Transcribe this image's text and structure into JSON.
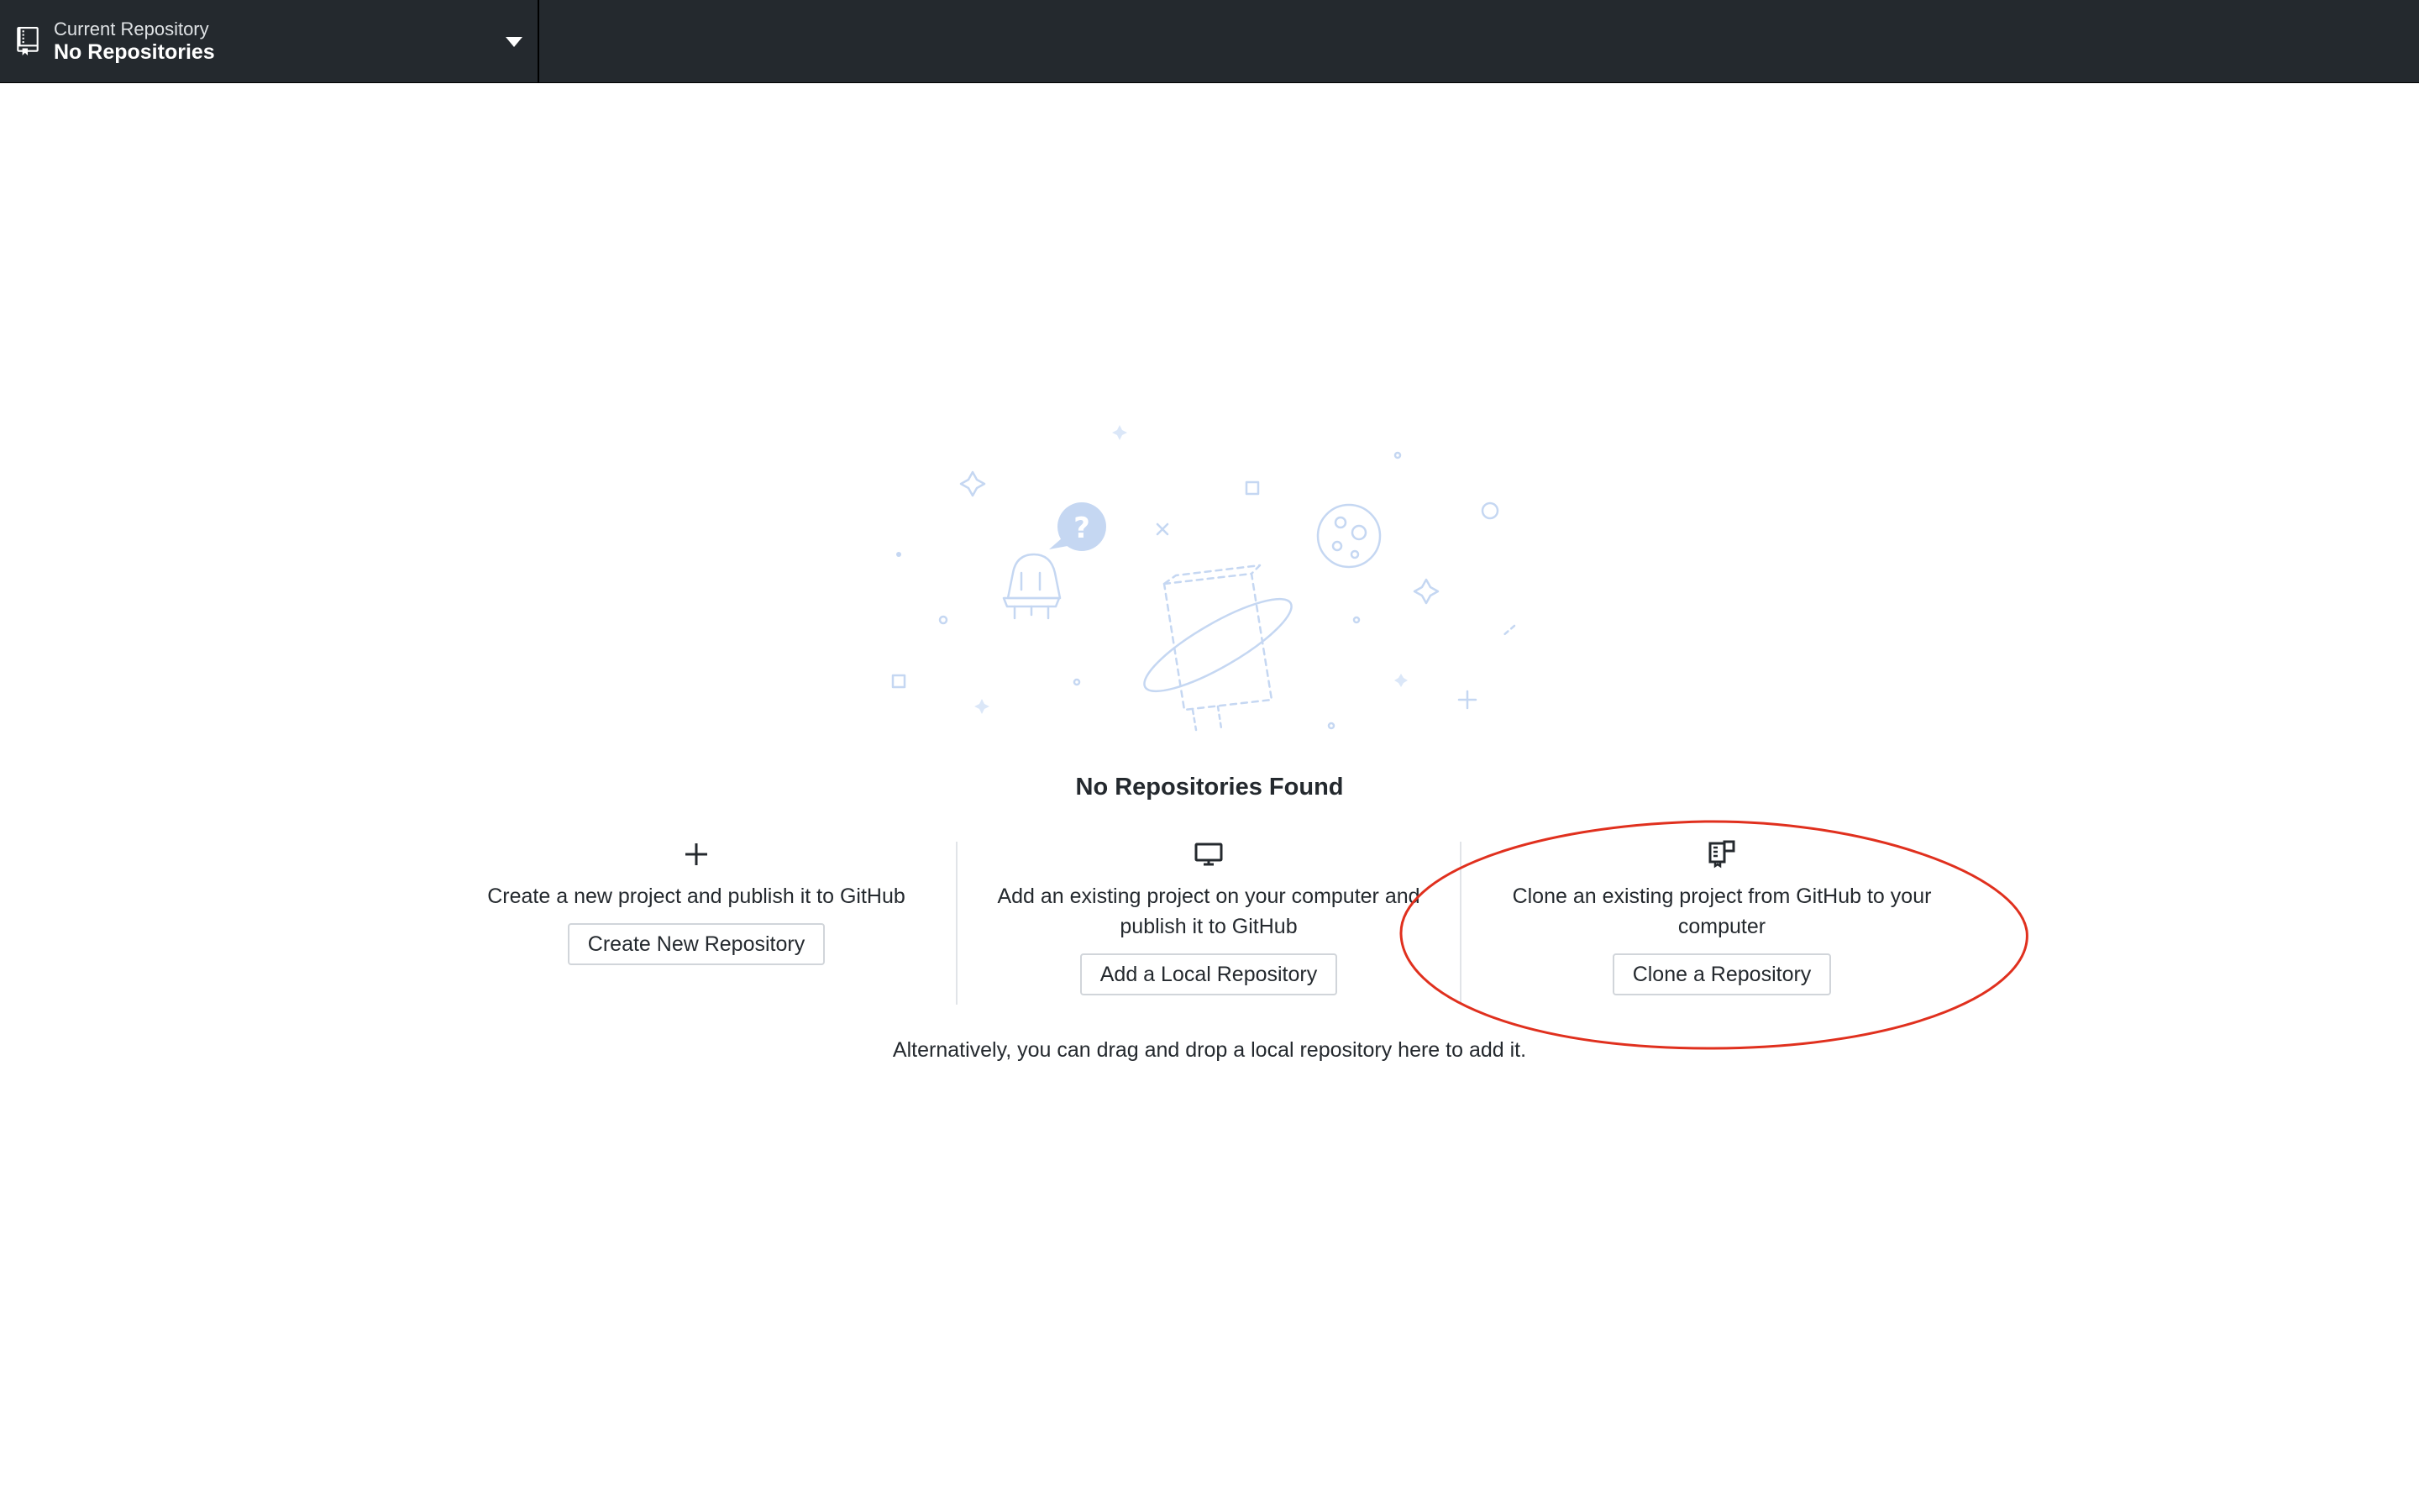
{
  "toolbar": {
    "repo_selector": {
      "caption": "Current Repository",
      "value": "No Repositories",
      "icon": "repo-icon",
      "dropdown_icon": "triangle-down-icon"
    }
  },
  "blankslate": {
    "title": "No Repositories Found",
    "actions": [
      {
        "icon": "plus-icon",
        "description": "Create a new project and publish it to GitHub",
        "button_label": "Create New Repository"
      },
      {
        "icon": "device-desktop-icon",
        "description": "Add an existing project on your computer and publish it to GitHub",
        "button_label": "Add a Local Repository"
      },
      {
        "icon": "repo-clone-icon",
        "description": "Clone an existing project from GitHub to your computer",
        "button_label": "Clone a Repository"
      }
    ],
    "footnote": "Alternatively, you can drag and drop a local repository here to add it."
  },
  "colors": {
    "toolbar_background": "#24292e",
    "illustration_stroke": "#c5d7f2",
    "annotation_ellipse": "#e0301e"
  }
}
